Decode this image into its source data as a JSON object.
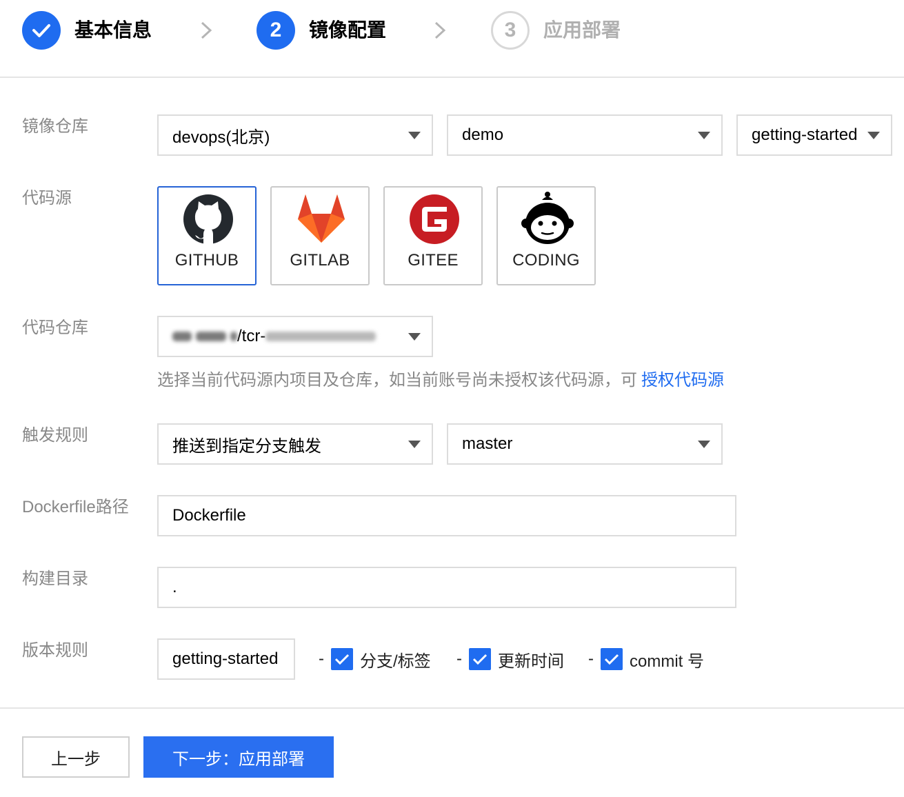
{
  "stepper": {
    "steps": [
      {
        "number": "",
        "label": "基本信息",
        "state": "done"
      },
      {
        "number": "2",
        "label": "镜像配置",
        "state": "active"
      },
      {
        "number": "3",
        "label": "应用部署",
        "state": "todo"
      }
    ]
  },
  "form": {
    "image_repo": {
      "label": "镜像仓库",
      "instance": "devops(北京)",
      "namespace": "demo",
      "repository": "getting-started"
    },
    "code_source": {
      "label": "代码源",
      "options": [
        {
          "name": "GITHUB",
          "icon": "github-icon",
          "selected": true
        },
        {
          "name": "GITLAB",
          "icon": "gitlab-icon",
          "selected": false
        },
        {
          "name": "GITEE",
          "icon": "gitee-icon",
          "selected": false
        },
        {
          "name": "CODING",
          "icon": "coding-icon",
          "selected": false
        }
      ]
    },
    "code_repo": {
      "label": "代码仓库",
      "value_visible": "/tcr-",
      "help_text": "选择当前代码源内项目及仓库，如当前账号尚未授权该代码源，可",
      "help_link": "授权代码源"
    },
    "trigger": {
      "label": "触发规则",
      "rule": "推送到指定分支触发",
      "branch": "master"
    },
    "dockerfile": {
      "label": "Dockerfile路径",
      "value": "Dockerfile"
    },
    "build_dir": {
      "label": "构建目录",
      "value": "."
    },
    "version": {
      "label": "版本规则",
      "prefix": "getting-started",
      "dash": "-",
      "options": [
        {
          "label": "分支/标签",
          "checked": true
        },
        {
          "label": "更新时间",
          "checked": true
        },
        {
          "label": "commit 号",
          "checked": true
        }
      ]
    }
  },
  "footer": {
    "prev_label": "上一步",
    "next_label": "下一步：应用部署"
  },
  "colors": {
    "primary": "#1f6cf0",
    "label_gray": "#888888",
    "border": "#dcdcdc"
  }
}
